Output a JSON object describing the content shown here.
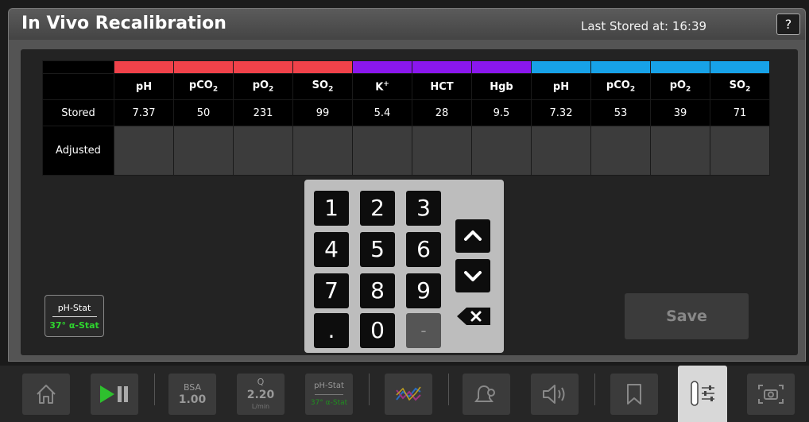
{
  "header": {
    "title": "In Vivo Recalibration",
    "last_stored": "Last Stored at: 16:39",
    "help_label": "?"
  },
  "table": {
    "columns": [
      {
        "label": "pH",
        "sub": "",
        "sup": "",
        "color": "#f0424a"
      },
      {
        "label": "pCO",
        "sub": "2",
        "sup": "",
        "color": "#f0424a"
      },
      {
        "label": "pO",
        "sub": "2",
        "sup": "",
        "color": "#f0424a"
      },
      {
        "label": "SO",
        "sub": "2",
        "sup": "",
        "color": "#f0424a"
      },
      {
        "label": "K",
        "sub": "",
        "sup": "+",
        "color": "#8a17ee"
      },
      {
        "label": "HCT",
        "sub": "",
        "sup": "",
        "color": "#8a17ee"
      },
      {
        "label": "Hgb",
        "sub": "",
        "sup": "",
        "color": "#8a17ee"
      },
      {
        "label": "pH",
        "sub": "",
        "sup": "",
        "color": "#17a2e8"
      },
      {
        "label": "pCO",
        "sub": "2",
        "sup": "",
        "color": "#17a2e8"
      },
      {
        "label": "pO",
        "sub": "2",
        "sup": "",
        "color": "#17a2e8"
      },
      {
        "label": "SO",
        "sub": "2",
        "sup": "",
        "color": "#17a2e8"
      }
    ],
    "rows": [
      {
        "label": "Stored",
        "values": [
          "7.37",
          "50",
          "231",
          "99",
          "5.4",
          "28",
          "9.5",
          "7.32",
          "53",
          "39",
          "71"
        ]
      },
      {
        "label": "Adjusted",
        "values": [
          "",
          "",
          "",
          "",
          "",
          "",
          "",
          "",
          "",
          "",
          ""
        ]
      }
    ]
  },
  "keypad": {
    "keys": [
      "1",
      "2",
      "3",
      "4",
      "5",
      "6",
      "7",
      "8",
      "9",
      ".",
      "0",
      "-"
    ]
  },
  "ph_stat_button": {
    "top": "pH-Stat",
    "bottom": "37° α-Stat"
  },
  "save_label": "Save",
  "bottom_bar": {
    "bsa_label": "BSA",
    "bsa_value": "1.00",
    "q_label": "Q",
    "q_value": "2.20",
    "q_unit": "L/min",
    "phstat_top": "pH-Stat",
    "phstat_bottom": "37° α-Stat"
  }
}
